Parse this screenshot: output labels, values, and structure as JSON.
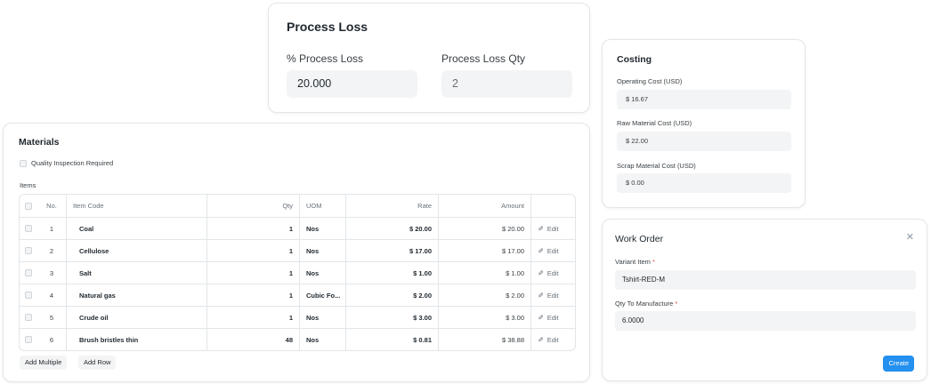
{
  "process_loss": {
    "title": "Process Loss",
    "pct_label": "% Process Loss",
    "pct_value": "20.000",
    "qty_label": "Process Loss Qty",
    "qty_value": "2"
  },
  "costing": {
    "title": "Costing",
    "fields": [
      {
        "label": "Operating Cost (USD)",
        "value": "$ 16.67"
      },
      {
        "label": "Raw Material Cost (USD)",
        "value": "$ 22.00"
      },
      {
        "label": "Scrap Material Cost (USD)",
        "value": "$ 0.00"
      }
    ]
  },
  "materials": {
    "title": "Materials",
    "quality_inspection_label": "Quality Inspection Required",
    "items_label": "Items",
    "columns": {
      "no": "No.",
      "item_code": "Item Code",
      "qty": "Qty",
      "uom": "UOM",
      "rate": "Rate",
      "amount": "Amount"
    },
    "edit_label": "Edit",
    "rows": [
      {
        "no": "1",
        "item_code": "Coal",
        "qty": "1",
        "uom": "Nos",
        "rate": "$ 20.00",
        "amount": "$ 20.00"
      },
      {
        "no": "2",
        "item_code": "Cellulose",
        "qty": "1",
        "uom": "Nos",
        "rate": "$ 17.00",
        "amount": "$ 17.00"
      },
      {
        "no": "3",
        "item_code": "Salt",
        "qty": "1",
        "uom": "Nos",
        "rate": "$ 1.00",
        "amount": "$ 1.00"
      },
      {
        "no": "4",
        "item_code": "Natural gas",
        "qty": "1",
        "uom": "Cubic Fo...",
        "rate": "$ 2.00",
        "amount": "$ 2.00"
      },
      {
        "no": "5",
        "item_code": "Crude oil",
        "qty": "1",
        "uom": "Nos",
        "rate": "$ 3.00",
        "amount": "$ 3.00"
      },
      {
        "no": "6",
        "item_code": "Brush bristles thin",
        "qty": "48",
        "uom": "Nos",
        "rate": "$ 0.81",
        "amount": "$ 38.88"
      }
    ],
    "add_multiple_label": "Add Multiple",
    "add_row_label": "Add Row"
  },
  "work_order": {
    "title": "Work Order",
    "close_glyph": "✕",
    "variant_item_label": "Variant Item",
    "variant_item_value": "Tshirt-RED-M",
    "qty_label": "Qty To Manufacture",
    "qty_value": "6.0000",
    "required_marker": "*",
    "create_label": "Create"
  },
  "colors": {
    "primary": "#2490ef",
    "required": "#e24c4c",
    "field_bg": "#f3f4f5"
  }
}
